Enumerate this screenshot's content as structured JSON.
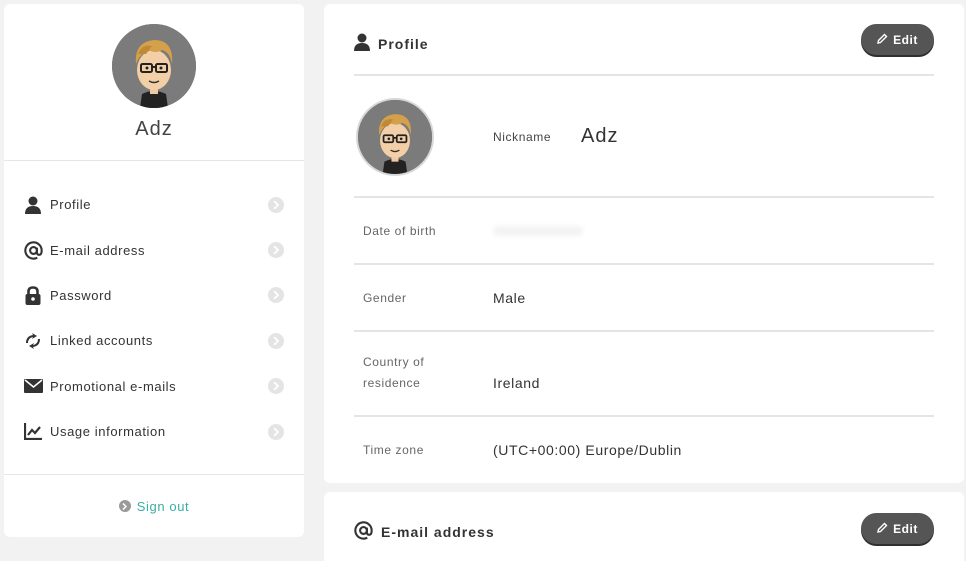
{
  "user": {
    "display_name": "Adz"
  },
  "sidebar": {
    "items": [
      {
        "label": "Profile",
        "icon": "person-icon"
      },
      {
        "label": "E-mail address",
        "icon": "at-icon"
      },
      {
        "label": "Password",
        "icon": "lock-icon"
      },
      {
        "label": "Linked accounts",
        "icon": "link-icon"
      },
      {
        "label": "Promotional e-mails",
        "icon": "envelope-icon"
      },
      {
        "label": "Usage information",
        "icon": "chart-icon"
      }
    ],
    "sign_out_label": "Sign out"
  },
  "profile": {
    "title": "Profile",
    "edit_label": "Edit",
    "nickname_label": "Nickname",
    "nickname_value": "Adz",
    "dob_label": "Date of birth",
    "gender_label": "Gender",
    "gender_value": "Male",
    "country_label_line1": "Country of",
    "country_label_line2": "residence",
    "country_value": "Ireland",
    "timezone_label": "Time zone",
    "timezone_value": "(UTC+00:00) Europe/Dublin"
  },
  "email_section": {
    "title": "E-mail address",
    "edit_label": "Edit"
  },
  "colors": {
    "accent": "#3aaea5",
    "button_dark": "#555555",
    "background": "#f2f2f2"
  }
}
